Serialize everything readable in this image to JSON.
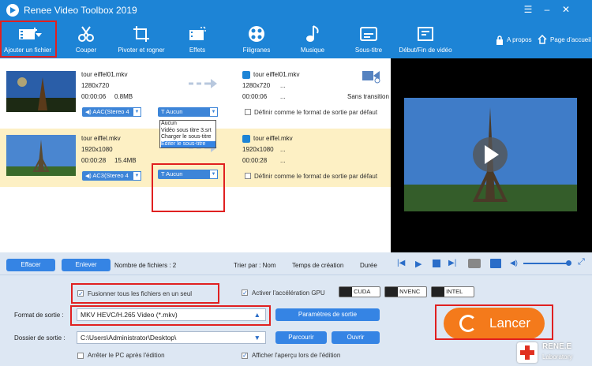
{
  "title": "Renee Video Toolbox 2019",
  "toolbar": {
    "items": [
      "Ajouter un fichier",
      "Couper",
      "Pivoter et rogner",
      "Effets",
      "Filigranes",
      "Musique",
      "Sous-titre",
      "Début/Fin de vidéo"
    ],
    "about": "A propos",
    "home": "Page d'accueil"
  },
  "files": [
    {
      "name": "tour eiffel01.mkv",
      "res": "1280x720",
      "dur": "00:00:06",
      "size": "0.8MB",
      "out_name": "tour eiffel01.mkv",
      "out_res": "1280x720",
      "out_dur": "00:00:06",
      "dots": "...",
      "dots2": "...",
      "audio": "AAC(Stereo 4",
      "subtitle": "Aucun",
      "checkbox": "Définir comme le format de sortie par défaut",
      "transition": "Sans transition"
    },
    {
      "name": "tour eiffel.mkv",
      "res": "1920x1080",
      "dur": "00:00:28",
      "size": "15.4MB",
      "out_name": "tour eiffel.mkv",
      "out_res": "1920x1080",
      "out_dur": "00:00:28",
      "dots": "...",
      "dots2": "...",
      "audio": "AC3(Stereo 4",
      "subtitle": "Aucun",
      "checkbox": "Définir comme le format de sortie par défaut"
    }
  ],
  "subtitle_dropdown": [
    "Aucun",
    "Vidéo sous titre 3.srt",
    "Charger le sous-titre",
    "Editer le sous-titre"
  ],
  "actions": {
    "clear": "Effacer",
    "remove": "Enlever",
    "count": "Nombre de fichiers : 2",
    "sort": "Trier par : Nom",
    "created": "Temps de création",
    "duration": "Durée"
  },
  "options": {
    "merge": "Fusionner tous les fichiers en un seul",
    "gpu": "Activer l'accélération GPU",
    "cuda": "CUDA",
    "nvenc": "NVENC",
    "intel": "INTEL"
  },
  "output": {
    "format_label": "Format de sortie :",
    "format_value": "MKV HEVC/H.265 Video (*.mkv)",
    "params": "Paramètres de sortie",
    "folder_label": "Dossier de sortie :",
    "folder_value": "C:\\Users\\Administrator\\Desktop\\",
    "browse": "Parcourir",
    "open": "Ouvrir",
    "shutdown": "Arrêter le PC après l'édition",
    "preview": "Afficher l'aperçu lors de l'édition"
  },
  "launch": "Lancer",
  "brand": {
    "name": "RENE.E",
    "sub": "Laboratory"
  }
}
